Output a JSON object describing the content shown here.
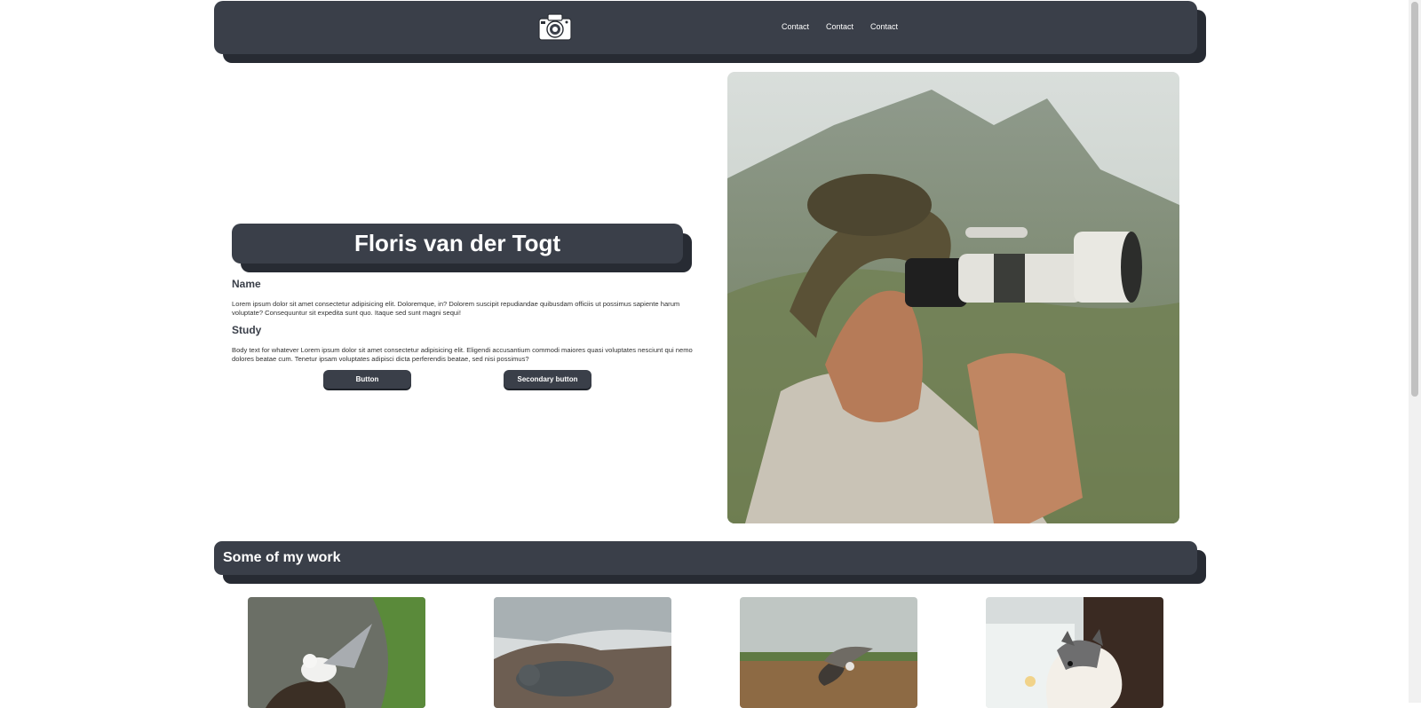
{
  "header": {
    "logo_icon": "camera-icon",
    "nav": [
      {
        "label": "Contact"
      },
      {
        "label": "Contact"
      },
      {
        "label": "Contact"
      }
    ]
  },
  "hero": {
    "title": "Floris van der Togt",
    "name_heading": "Name",
    "name_text": "Lorem ipsum dolor sit amet consectetur adipisicing elit. Doloremque, in? Dolorem suscipit repudiandae quibusdam officiis ut possimus sapiente harum voluptate? Consequuntur sit expedita sunt quo. Itaque sed sunt magni sequi!",
    "study_heading": "Study",
    "study_text": "Body text for whatever Lorem ipsum dolor sit amet consectetur adipisicing elit. Eligendi accusantium commodi maiores quasi voluptates nesciunt qui nemo dolores beatae cum. Tenetur ipsam voluptates adipisci dicta perferendis beatae, sed nisi possimus?",
    "primary_button": "Button",
    "secondary_button": "Secondary button"
  },
  "work": {
    "heading": "Some of my work",
    "thumbnails": [
      {
        "subject": "seabird-on-cliff"
      },
      {
        "subject": "seal-on-rocks"
      },
      {
        "subject": "bird-in-flight"
      },
      {
        "subject": "sheltie-dog"
      }
    ]
  },
  "colors": {
    "panel": "#3a3f49",
    "panel_shadow": "#272b33",
    "text_light": "#ffffff"
  }
}
